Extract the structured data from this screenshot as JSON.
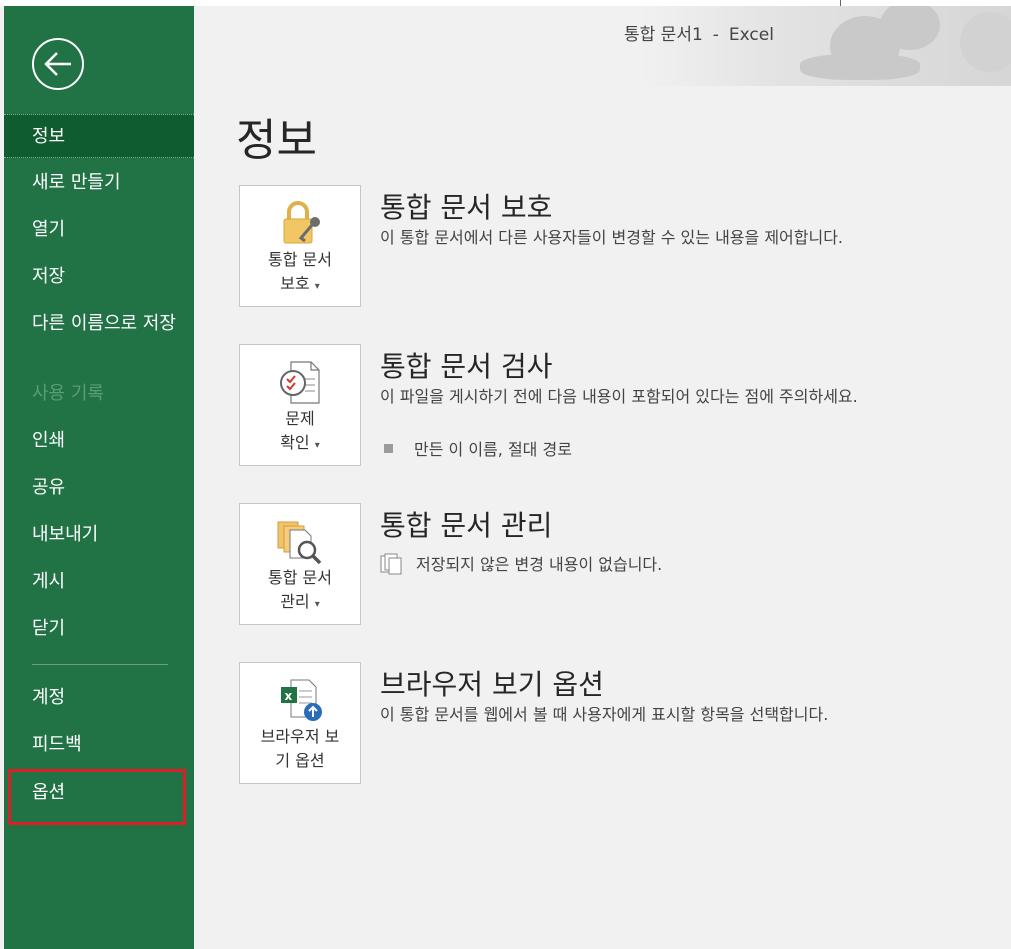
{
  "window": {
    "document_name": "통합 문서1",
    "separator": "-",
    "app_name": "Excel"
  },
  "nav": {
    "items": [
      {
        "label": "정보",
        "state": "selected"
      },
      {
        "label": "새로 만들기",
        "state": "normal"
      },
      {
        "label": "열기",
        "state": "normal"
      },
      {
        "label": "저장",
        "state": "normal"
      },
      {
        "label": "다른 이름으로 저장",
        "state": "normal"
      },
      {
        "label": "사용 기록",
        "state": "disabled"
      },
      {
        "label": "인쇄",
        "state": "normal"
      },
      {
        "label": "공유",
        "state": "normal"
      },
      {
        "label": "내보내기",
        "state": "normal"
      },
      {
        "label": "게시",
        "state": "normal"
      },
      {
        "label": "닫기",
        "state": "normal"
      },
      {
        "label": "계정",
        "state": "normal"
      },
      {
        "label": "피드백",
        "state": "normal"
      },
      {
        "label": "옵션",
        "state": "highlighted"
      }
    ]
  },
  "page": {
    "title": "정보"
  },
  "sections": {
    "protect": {
      "tile_line1": "통합 문서",
      "tile_line2": "보호",
      "heading": "통합 문서 보호",
      "description": "이 통합 문서에서 다른 사용자들이 변경할 수 있는 내용을 제어합니다."
    },
    "inspect": {
      "tile_line1": "문제",
      "tile_line2": "확인",
      "heading": "통합 문서 검사",
      "description": "이 파일을 게시하기 전에 다음 내용이 포함되어 있다는 점에 주의하세요.",
      "bullet": "만든 이 이름, 절대 경로"
    },
    "manage": {
      "tile_line1": "통합 문서",
      "tile_line2": "관리",
      "heading": "통합 문서 관리",
      "description": "저장되지 않은 변경 내용이 없습니다."
    },
    "browser": {
      "tile_line1": "브라우저 보",
      "tile_line2": "기 옵션",
      "heading": "브라우저 보기 옵션",
      "description": "이 통합 문서를 웹에서 볼 때 사용자에게 표시할 항목을 선택합니다."
    }
  },
  "colors": {
    "nav_background": "#217346",
    "nav_selected": "#0e5c2f",
    "highlight_border": "#d92027",
    "page_background": "#f1f1f1"
  }
}
